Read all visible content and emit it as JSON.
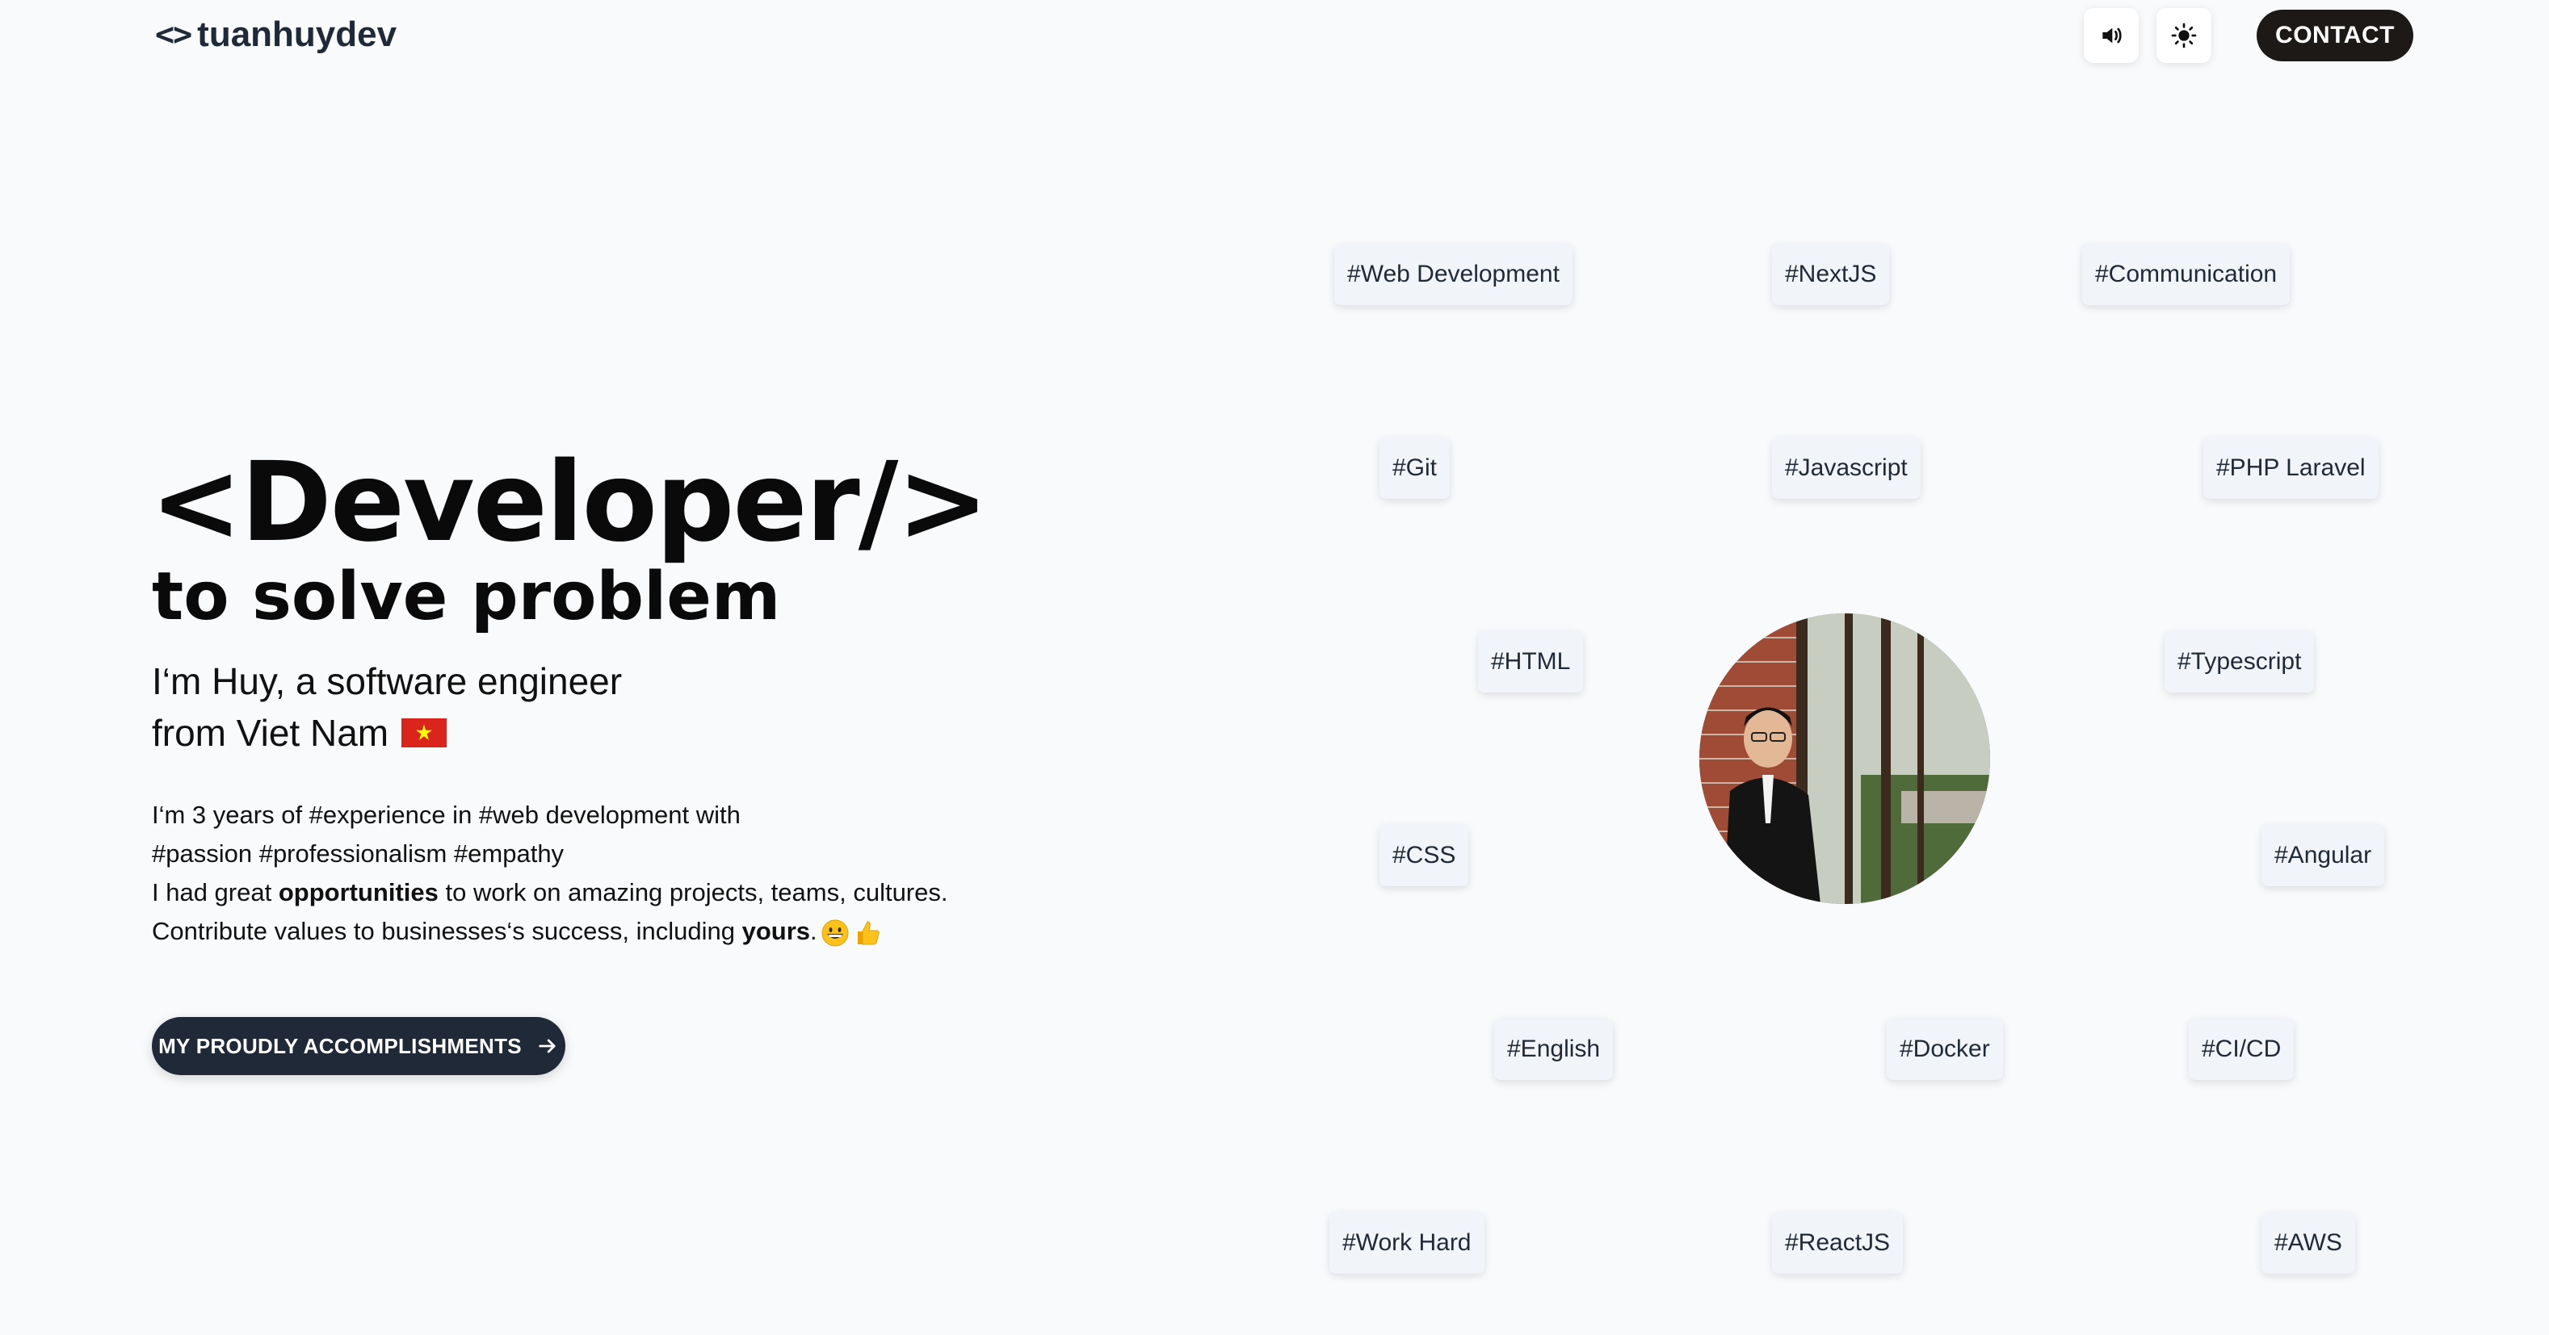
{
  "header": {
    "logo_symbol": "<>",
    "logo_text": "tuanhuydev",
    "contact_label": "CONTACT"
  },
  "hero": {
    "title": "<Developer/>",
    "subtitle": "to solve problem",
    "intro_line1": "I‘m Huy, a software engineer",
    "intro_line2": "from Viet Nam",
    "desc_line1": "I‘m 3 years of #experience in #web development with",
    "desc_line2": "#passion #professionalism #empathy",
    "desc_line3_pre": "I had great ",
    "desc_line3_bold": "opportunities",
    "desc_line3_post": " to work on amazing projects, teams, cultures.",
    "desc_line4_pre": "Contribute values to businesses‘s success, including ",
    "desc_line4_bold": "yours",
    "desc_line4_post": ".",
    "cta_label": "MY PROUDLY ACCOMPLISHMENTS"
  },
  "tags": [
    "#Web Development",
    "#NextJS",
    "#Communication",
    "#Git",
    "#Javascript",
    "#PHP Laravel",
    "#HTML",
    "#Typescript",
    "#CSS",
    "#Angular",
    "#English",
    "#Docker",
    "#CI/CD",
    "#Work Hard",
    "#ReactJS",
    "#AWS"
  ],
  "icons": {
    "sound": "speaker-icon",
    "theme": "sun-icon",
    "cta_arrow": "arrow-right-icon",
    "flag": "vietnam-flag-icon",
    "emoji1": "grinning-face-icon",
    "emoji2": "thumbs-up-icon"
  },
  "colors": {
    "background": "#f8fafc",
    "contact_bg": "#1c1917",
    "cta_bg": "#1f2937",
    "tag_bg": "#f1f5f9"
  }
}
